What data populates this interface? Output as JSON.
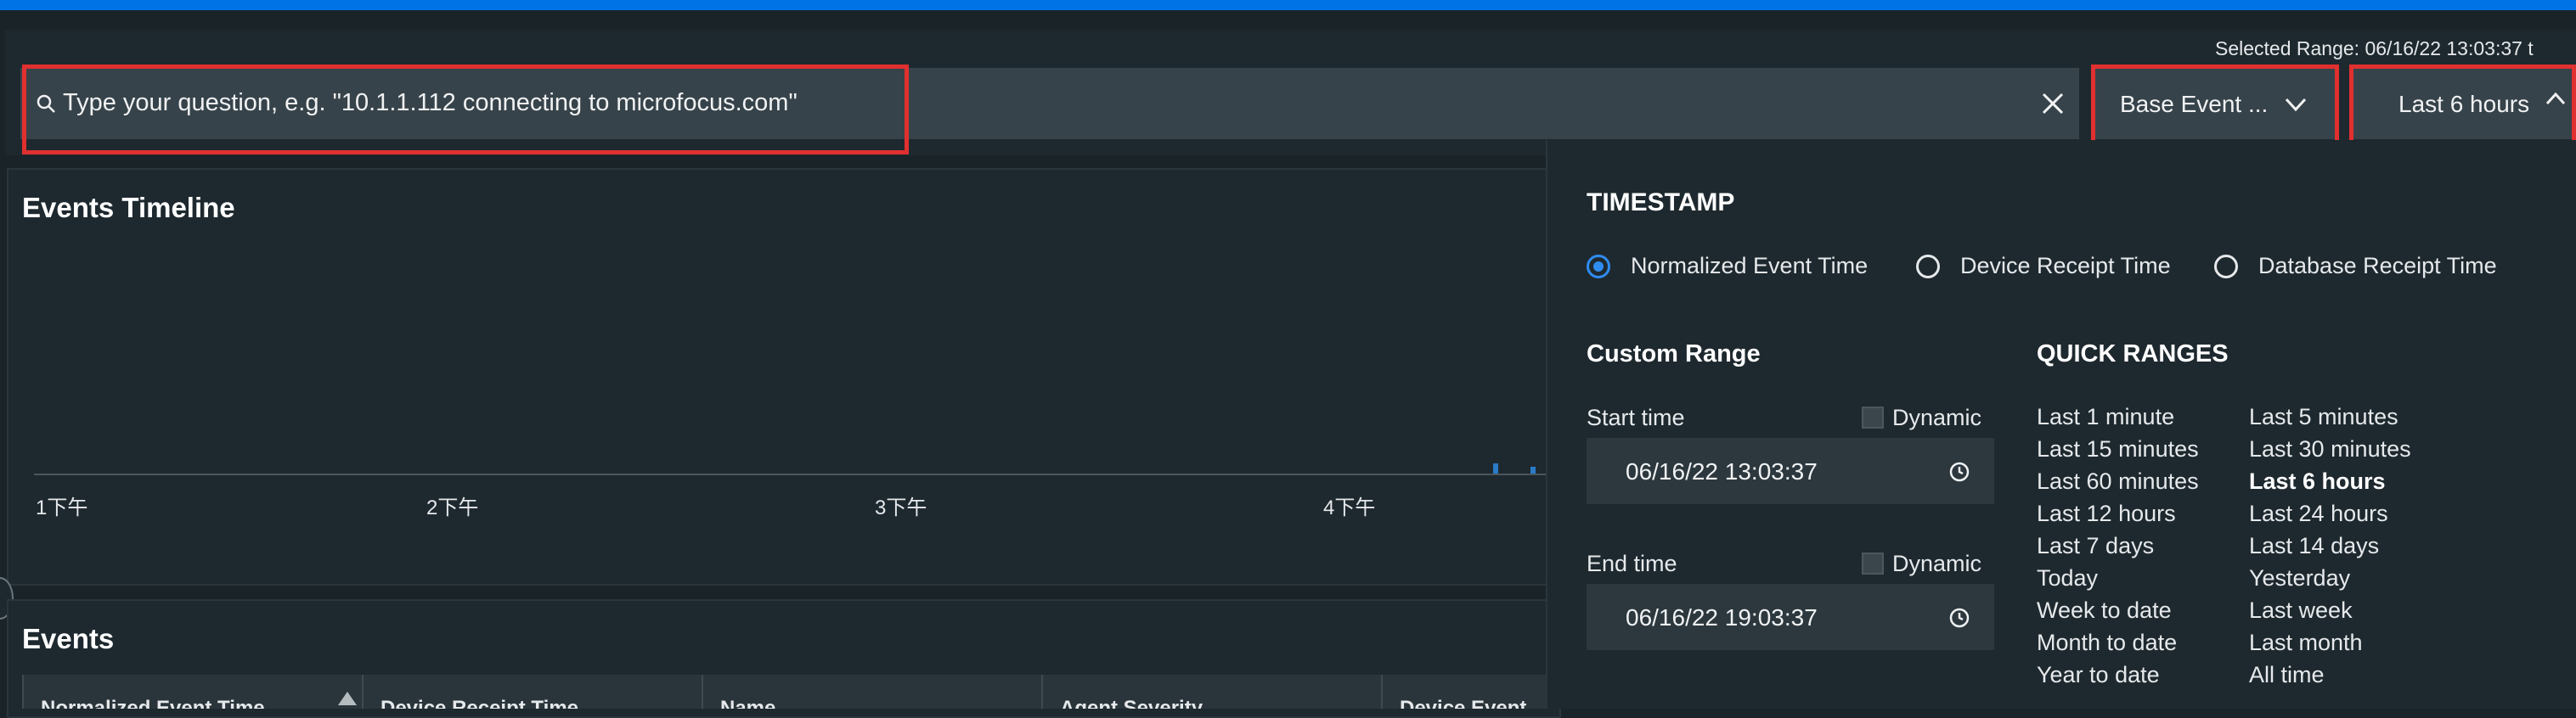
{
  "header": {
    "selected_range_label": "Selected Range:",
    "selected_range_value": "06/16/22 13:03:37  t"
  },
  "search": {
    "placeholder": "Type your question, e.g. \"10.1.1.112 connecting to microfocus.com\"",
    "icon": "search-icon",
    "clear_icon": "close-icon"
  },
  "event_type_select": {
    "label": "Base Event ...",
    "icon": "chevron-down-icon"
  },
  "time_range_select": {
    "label": "Last 6 hours",
    "icon": "chevron-up-icon"
  },
  "timeline": {
    "title": "Events Timeline",
    "ticks": [
      "1下午",
      "2下午",
      "3下午",
      "4下午"
    ]
  },
  "events": {
    "title": "Events",
    "columns": [
      "Normalized Event Time",
      "Device Receipt Time",
      "Name",
      "Agent Severity",
      "Device Event"
    ]
  },
  "dropdown": {
    "timestamp_heading": "TIMESTAMP",
    "timestamp_options": [
      {
        "label": "Normalized Event Time",
        "selected": true
      },
      {
        "label": "Device Receipt Time",
        "selected": false
      },
      {
        "label": "Database Receipt Time",
        "selected": false
      }
    ],
    "custom_range": {
      "heading": "Custom Range",
      "start_label": "Start time",
      "start_value": "06/16/22 13:03:37",
      "end_label": "End time",
      "end_value": "06/16/22 19:03:37",
      "dynamic_label": "Dynamic"
    },
    "quick_ranges": {
      "heading": "QUICK RANGES",
      "col1": [
        "Last 1 minute",
        "Last 15 minutes",
        "Last 60 minutes",
        "Last 12 hours",
        "Last 7 days",
        "Today",
        "Week to date",
        "Month to date",
        "Year to date"
      ],
      "col2": [
        "Last 5 minutes",
        "Last 30 minutes",
        "Last 6 hours",
        "Last 24 hours",
        "Last 14 days",
        "Yesterday",
        "Last week",
        "Last month",
        "All time"
      ],
      "active": "Last 6 hours"
    }
  },
  "colors": {
    "accent": "#0073e7",
    "highlight": "#e0302f",
    "radio_selected": "#2f8cf0"
  }
}
